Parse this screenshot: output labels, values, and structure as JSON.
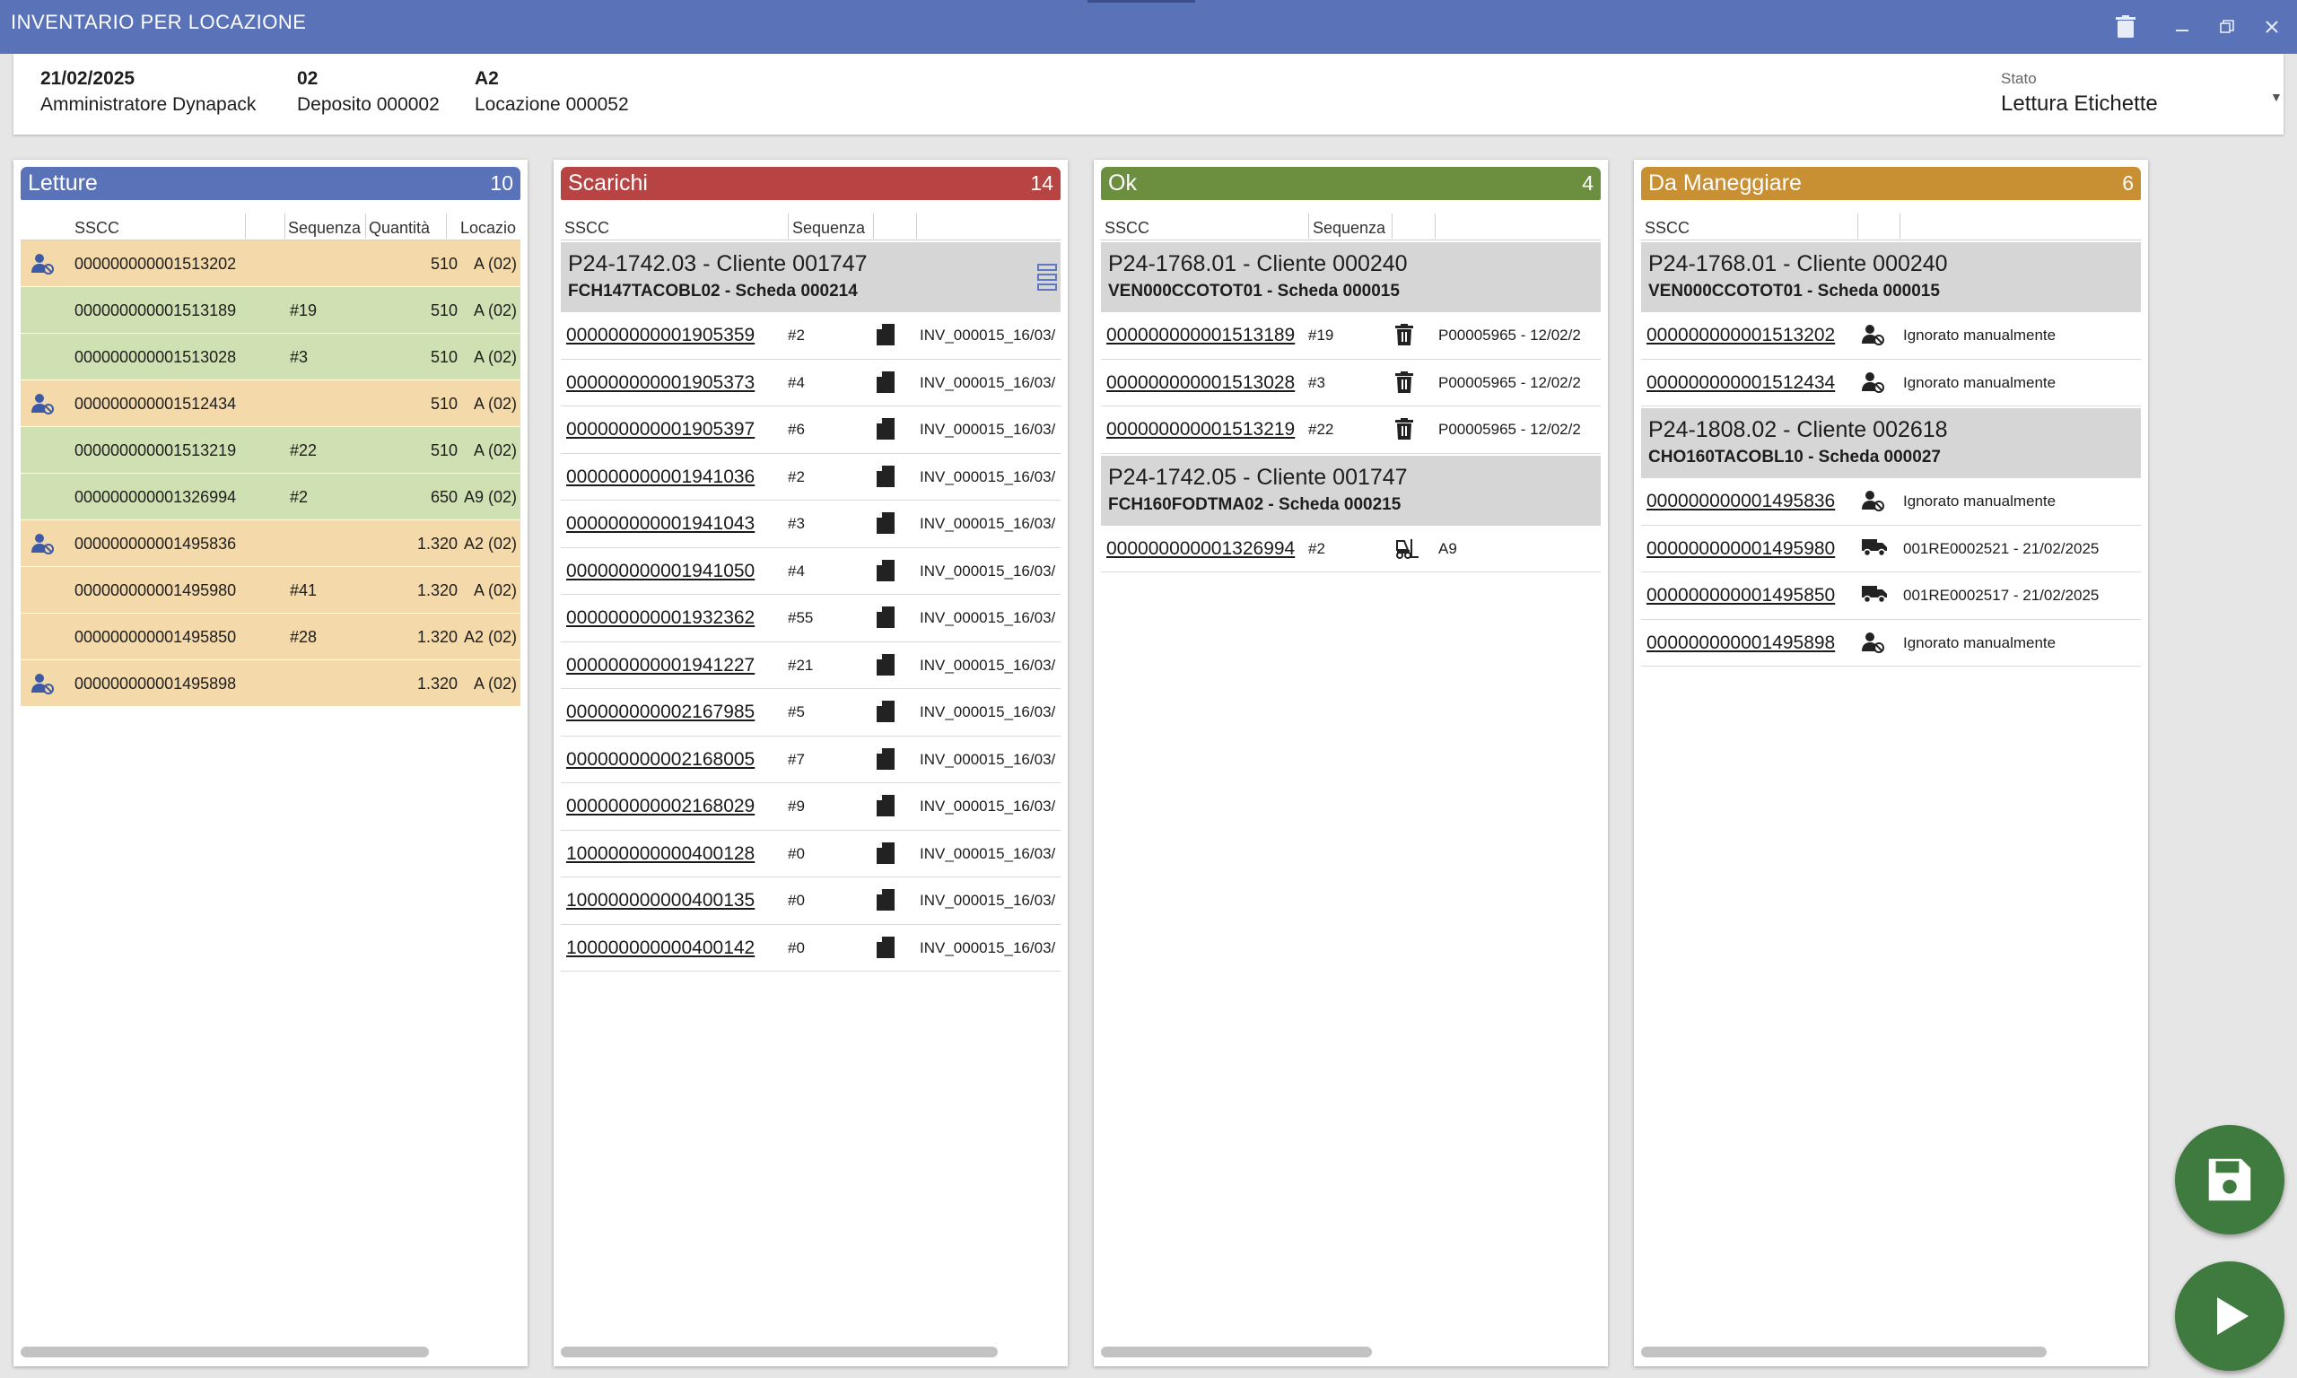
{
  "window": {
    "title": "INVENTARIO PER LOCAZIONE"
  },
  "info": {
    "date": "21/02/2025",
    "user": "Amministratore Dynapack",
    "deposito_code": "02",
    "deposito": "Deposito 000002",
    "locazione_code": "A2",
    "locazione": "Locazione 000052",
    "stato_label": "Stato",
    "stato_value": "Lettura Etichette"
  },
  "letture": {
    "title": "Letture",
    "count": "10",
    "color": "#5a73b8",
    "columns": [
      "SSCC",
      "Sequenza",
      "Quantità",
      "Locazio"
    ],
    "rows": [
      {
        "sscc": "000000000001513202",
        "seq": "",
        "qty": "510",
        "loc": "A (02)",
        "status": "orange",
        "icon": "user-blocked-icon"
      },
      {
        "sscc": "000000000001513189",
        "seq": "#19",
        "qty": "510",
        "loc": "A (02)",
        "status": "green",
        "icon": ""
      },
      {
        "sscc": "000000000001513028",
        "seq": "#3",
        "qty": "510",
        "loc": "A (02)",
        "status": "green",
        "icon": ""
      },
      {
        "sscc": "000000000001512434",
        "seq": "",
        "qty": "510",
        "loc": "A (02)",
        "status": "orange",
        "icon": "user-blocked-icon"
      },
      {
        "sscc": "000000000001513219",
        "seq": "#22",
        "qty": "510",
        "loc": "A (02)",
        "status": "green",
        "icon": ""
      },
      {
        "sscc": "000000000001326994",
        "seq": "#2",
        "qty": "650",
        "loc": "A9 (02)",
        "status": "green",
        "icon": ""
      },
      {
        "sscc": "000000000001495836",
        "seq": "",
        "qty": "1.320",
        "loc": "A2 (02)",
        "status": "orange",
        "icon": "user-blocked-icon"
      },
      {
        "sscc": "000000000001495980",
        "seq": "#41",
        "qty": "1.320",
        "loc": "A (02)",
        "status": "orange",
        "icon": ""
      },
      {
        "sscc": "000000000001495850",
        "seq": "#28",
        "qty": "1.320",
        "loc": "A2 (02)",
        "status": "orange",
        "icon": ""
      },
      {
        "sscc": "000000000001495898",
        "seq": "",
        "qty": "1.320",
        "loc": "A (02)",
        "status": "orange",
        "icon": "user-blocked-icon"
      }
    ]
  },
  "scarichi": {
    "title": "Scarichi",
    "count": "14",
    "color": "#b84343",
    "columns": [
      "SSCC",
      "Sequenza"
    ],
    "groups": [
      {
        "title": "P24-1742.03 - Cliente 001747",
        "subtitle": "FCH147TACOBL02 - Scheda 000214",
        "rows": [
          {
            "sscc": "000000000001905359",
            "seq": "#2",
            "icon": "document-icon",
            "note": "INV_000015_16/03/"
          },
          {
            "sscc": "000000000001905373",
            "seq": "#4",
            "icon": "document-icon",
            "note": "INV_000015_16/03/"
          },
          {
            "sscc": "000000000001905397",
            "seq": "#6",
            "icon": "document-icon",
            "note": "INV_000015_16/03/"
          },
          {
            "sscc": "000000000001941036",
            "seq": "#2",
            "icon": "document-icon",
            "note": "INV_000015_16/03/"
          },
          {
            "sscc": "000000000001941043",
            "seq": "#3",
            "icon": "document-icon",
            "note": "INV_000015_16/03/"
          },
          {
            "sscc": "000000000001941050",
            "seq": "#4",
            "icon": "document-icon",
            "note": "INV_000015_16/03/"
          },
          {
            "sscc": "000000000001932362",
            "seq": "#55",
            "icon": "document-icon",
            "note": "INV_000015_16/03/"
          },
          {
            "sscc": "000000000001941227",
            "seq": "#21",
            "icon": "document-icon",
            "note": "INV_000015_16/03/"
          },
          {
            "sscc": "000000000002167985",
            "seq": "#5",
            "icon": "document-icon",
            "note": "INV_000015_16/03/"
          },
          {
            "sscc": "000000000002168005",
            "seq": "#7",
            "icon": "document-icon",
            "note": "INV_000015_16/03/"
          },
          {
            "sscc": "000000000002168029",
            "seq": "#9",
            "icon": "document-icon",
            "note": "INV_000015_16/03/"
          },
          {
            "sscc": "100000000000400128",
            "seq": "#0",
            "icon": "document-icon",
            "note": "INV_000015_16/03/"
          },
          {
            "sscc": "100000000000400135",
            "seq": "#0",
            "icon": "document-icon",
            "note": "INV_000015_16/03/"
          },
          {
            "sscc": "100000000000400142",
            "seq": "#0",
            "icon": "document-icon",
            "note": "INV_000015_16/03/"
          }
        ]
      }
    ]
  },
  "ok": {
    "title": "Ok",
    "count": "4",
    "color": "#6b8f3f",
    "columns": [
      "SSCC",
      "Sequenza"
    ],
    "groups": [
      {
        "title": "P24-1768.01 - Cliente 000240",
        "subtitle": "VEN000CCOTOT01 - Scheda 000015",
        "rows": [
          {
            "sscc": "000000000001513189",
            "seq": "#19",
            "icon": "trash-icon",
            "note": "P00005965 - 12/02/2"
          },
          {
            "sscc": "000000000001513028",
            "seq": "#3",
            "icon": "trash-icon",
            "note": "P00005965 - 12/02/2"
          },
          {
            "sscc": "000000000001513219",
            "seq": "#22",
            "icon": "trash-icon",
            "note": "P00005965 - 12/02/2"
          }
        ]
      },
      {
        "title": "P24-1742.05 - Cliente 001747",
        "subtitle": "FCH160FODTMA02 - Scheda 000215",
        "rows": [
          {
            "sscc": "000000000001326994",
            "seq": "#2",
            "icon": "forklift-icon",
            "note": "A9"
          }
        ]
      }
    ]
  },
  "da_maneggiare": {
    "title": "Da Maneggiare",
    "count": "6",
    "color": "#c98f33",
    "columns": [
      "SSCC"
    ],
    "groups": [
      {
        "title": "P24-1768.01 - Cliente 000240",
        "subtitle": "VEN000CCOTOT01 - Scheda 000015",
        "rows": [
          {
            "sscc": "000000000001513202",
            "icon": "user-blocked-icon",
            "note": "Ignorato manualmente"
          },
          {
            "sscc": "000000000001512434",
            "icon": "user-blocked-icon",
            "note": "Ignorato manualmente"
          }
        ]
      },
      {
        "title": "P24-1808.02 - Cliente 002618",
        "subtitle": "CHO160TACOBL10 - Scheda 000027",
        "rows": [
          {
            "sscc": "000000000001495836",
            "icon": "user-blocked-icon",
            "note": "Ignorato manualmente"
          },
          {
            "sscc": "000000000001495980",
            "icon": "truck-icon",
            "note": "001RE0002521 - 21/02/2025"
          },
          {
            "sscc": "000000000001495850",
            "icon": "truck-icon",
            "note": "001RE0002517 - 21/02/2025"
          },
          {
            "sscc": "000000000001495898",
            "icon": "user-blocked-icon",
            "note": "Ignorato manualmente"
          }
        ]
      }
    ]
  },
  "actions": {
    "save_icon": "save-icon",
    "play_icon": "play-icon",
    "color": "#3f7b3f"
  }
}
